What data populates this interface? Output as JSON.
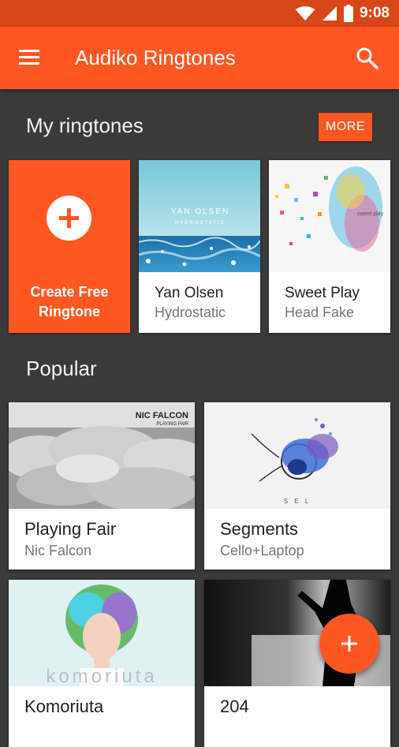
{
  "status_bar": {
    "time": "9:08"
  },
  "app_bar": {
    "title": "Audiko Ringtones"
  },
  "my_ringtones": {
    "heading": "My ringtones",
    "more_label": "MORE",
    "create_line1": "Create Free",
    "create_line2": "Ringtone",
    "items": [
      {
        "title": "Yan Olsen",
        "subtitle": "Hydrostatic",
        "art_text1": "YAN OLSEN",
        "art_text2": "HYDROSTATIC"
      },
      {
        "title": "Sweet Play",
        "subtitle": "Head Fake",
        "art_text": "sweet play"
      }
    ]
  },
  "popular": {
    "heading": "Popular",
    "items": [
      {
        "title": "Playing Fair",
        "subtitle": "Nic Falcon",
        "art_text1": "NIC FALCON",
        "art_text2": "PLAYING FAIR"
      },
      {
        "title": "Segments",
        "subtitle": "Cello+Laptop",
        "art_text": "S E L"
      },
      {
        "title": "Komoriuta",
        "subtitle": "",
        "art_text": "komoriuta"
      },
      {
        "title": "204",
        "subtitle": ""
      }
    ]
  },
  "colors": {
    "accent": "#fe5722",
    "status_bar": "#d9461a",
    "background": "#3a3a3a"
  },
  "icons": [
    "wifi-icon",
    "signal-icon",
    "battery-icon",
    "menu-icon",
    "search-icon",
    "plus-icon"
  ]
}
